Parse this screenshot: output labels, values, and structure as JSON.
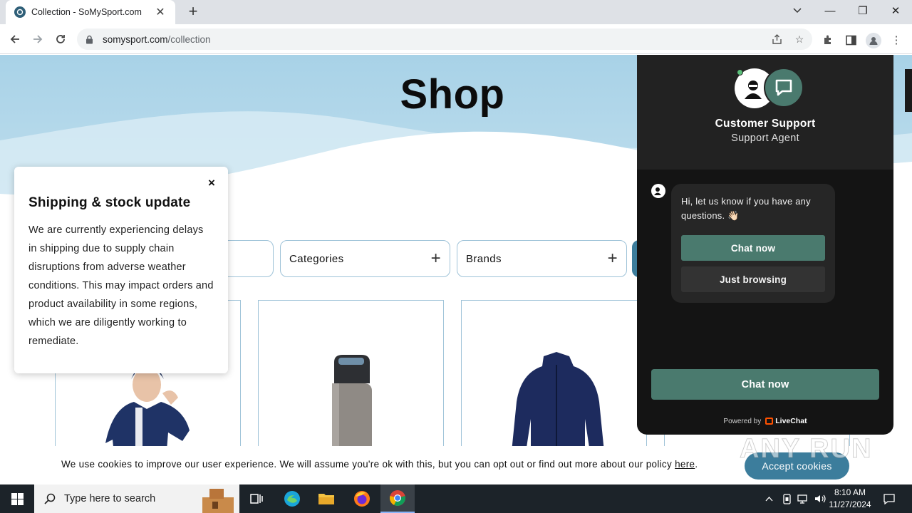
{
  "browser": {
    "tab_title": "Collection - SoMySport.com",
    "url_host": "somysport.com",
    "url_path": "/collection"
  },
  "page": {
    "title": "Shop",
    "filters": [
      {
        "label": ""
      },
      {
        "label": "Categories"
      },
      {
        "label": "Brands"
      }
    ]
  },
  "shipping_popup": {
    "title": "Shipping & stock update",
    "text": "We are currently experiencing delays in shipping due to supply chain disruptions from adverse weather conditions. This may impact orders and product availability in some regions, which we are diligently working to remediate.",
    "close_symbol": "×"
  },
  "chat": {
    "agent_name": "Customer Support",
    "agent_role": "Support Agent",
    "message": "Hi, let us know if you have any questions. 👋🏻",
    "btn_chat_now": "Chat now",
    "btn_just_browsing": "Just browsing",
    "main_button": "Chat now",
    "powered_by": "Powered by",
    "brand": "LiveChat"
  },
  "cookie": {
    "text": "We use cookies to improve our user experience. We will assume you're ok with this, but you can opt out or find out more about our policy",
    "link": "here",
    "suffix": ".",
    "button": "Accept cookies"
  },
  "watermark": "ANY RUN",
  "taskbar": {
    "search_placeholder": "Type here to search",
    "time": "8:10 AM",
    "date": "11/27/2024"
  },
  "colors": {
    "accent_teal": "#4a7a6e",
    "cookie_button": "#3c7d9c",
    "hero_blue": "#a9d3e8",
    "card_border": "#9fc3d8"
  }
}
